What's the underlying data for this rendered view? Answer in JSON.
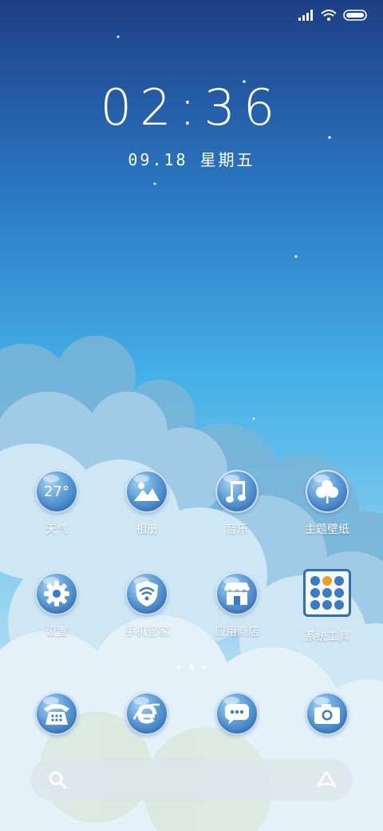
{
  "status_bar": {
    "signal_icon": "signal-bars-icon",
    "wifi_icon": "wifi-icon",
    "battery_icon": "battery-icon"
  },
  "lock": {
    "time": "02:36",
    "date": "09.18 星期五"
  },
  "apps": [
    {
      "id": "weather",
      "label": "天气",
      "icon": "weather-icon",
      "badge": "27°"
    },
    {
      "id": "gallery",
      "label": "相册",
      "icon": "gallery-icon"
    },
    {
      "id": "music",
      "label": "音乐",
      "icon": "music-icon"
    },
    {
      "id": "themes",
      "label": "主题壁纸",
      "icon": "clover-icon"
    },
    {
      "id": "settings",
      "label": "设置",
      "icon": "gear-icon"
    },
    {
      "id": "security",
      "label": "手机管家",
      "icon": "shield-wifi-icon"
    },
    {
      "id": "appstore",
      "label": "应用商店",
      "icon": "store-icon"
    },
    {
      "id": "tools",
      "label": "系统工具",
      "icon": "folder-grid-icon"
    }
  ],
  "dock": [
    {
      "id": "phone",
      "icon": "phone-icon"
    },
    {
      "id": "browser",
      "icon": "browser-icon"
    },
    {
      "id": "messages",
      "icon": "messages-icon"
    },
    {
      "id": "camera",
      "icon": "camera-icon"
    }
  ],
  "page_indicator": {
    "count": 3,
    "active": 2
  },
  "search_bar": {
    "search_icon": "search-icon",
    "assistant_icon": "assistant-icon"
  },
  "colors": {
    "sky_top": "#1e4f95",
    "sky_mid": "#3aa6e0",
    "cloud": "#cfe6f4",
    "icon_blue": "#2e6fb5"
  }
}
